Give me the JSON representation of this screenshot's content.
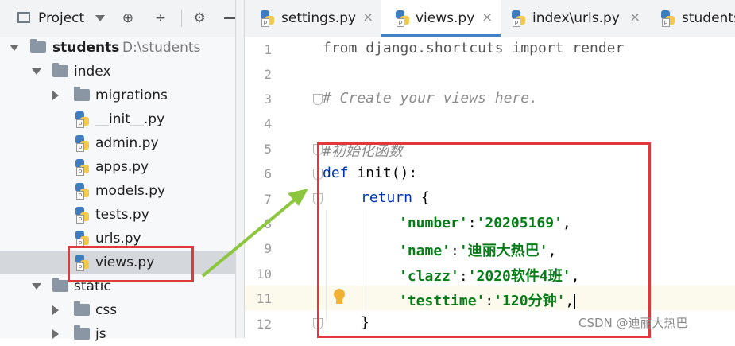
{
  "project_toolbar": {
    "title": "Project",
    "icons": [
      "chevron-down-icon",
      "crosshair-icon",
      "collapse-icon",
      "gear-icon",
      "minimize-icon"
    ]
  },
  "tree": {
    "root": {
      "name": "students",
      "path": "D:\\students"
    },
    "items": [
      {
        "label": "index"
      },
      {
        "label": "migrations"
      },
      {
        "label": "__init__.py"
      },
      {
        "label": "admin.py"
      },
      {
        "label": "apps.py"
      },
      {
        "label": "models.py"
      },
      {
        "label": "tests.py"
      },
      {
        "label": "urls.py"
      },
      {
        "label": "views.py"
      },
      {
        "label": "static"
      },
      {
        "label": "css"
      },
      {
        "label": "js"
      }
    ]
  },
  "tabs": [
    {
      "label": "settings.py",
      "close": "×"
    },
    {
      "label": "views.py",
      "close": "×"
    },
    {
      "label": "index\\urls.py",
      "close": "×"
    },
    {
      "label": "students"
    }
  ],
  "editor": {
    "line_numbers": [
      "1",
      "2",
      "3",
      "4",
      "5",
      "6",
      "7",
      "8",
      "9",
      "10",
      "11",
      "12"
    ],
    "lines": {
      "l1_from": "from",
      "l1_mod": " django.shortcuts ",
      "l1_import": "import",
      "l1_name": " render",
      "l3": "# Create your views here.",
      "l5": "#初始化函数",
      "l6_def": "def",
      "l6_rest": " init():",
      "l7_return": "return",
      "l7_rest": " {",
      "l8_key": "'number'",
      "l8_val": "'20205169'",
      "l9_key": "'name'",
      "l9_val": "'迪丽大热巴'",
      "l10_key": "'clazz'",
      "l10_val": "'2020软件4班'",
      "l11_key": "'testtime'",
      "l11_val": "'120分钟'",
      "l12": "}",
      "colon": ":",
      "comma": ","
    }
  },
  "watermark": "CSDN @迪丽大热巴",
  "colors": {
    "highlight_box": "#e0383b",
    "arrow": "#8cc63e",
    "keyword": "#0033b3",
    "string": "#067d17"
  }
}
